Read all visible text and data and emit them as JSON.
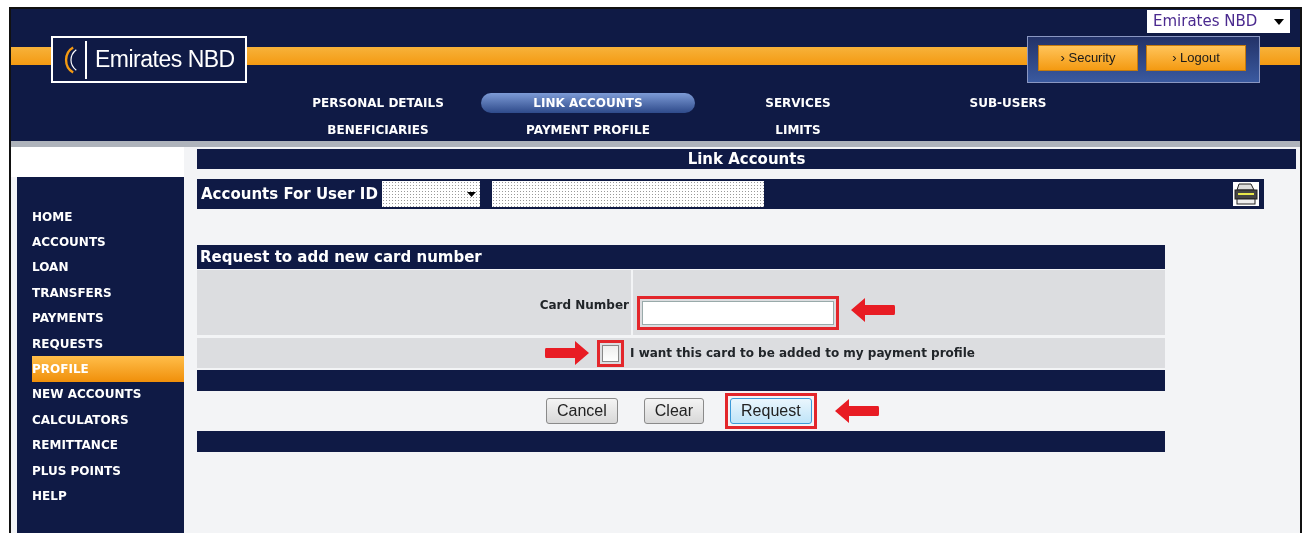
{
  "language_select": {
    "value": "Emirates NBD"
  },
  "logo": {
    "text": "Emirates NBD"
  },
  "header_buttons": [
    {
      "label": "› Security"
    },
    {
      "label": "› Logout"
    }
  ],
  "tabs": [
    {
      "label": "PERSONAL DETAILS",
      "selected": false
    },
    {
      "label": "LINK ACCOUNTS",
      "selected": true
    },
    {
      "label": "SERVICES",
      "selected": false
    },
    {
      "label": "SUB-USERS",
      "selected": false
    },
    {
      "label": "BENEFICIARIES",
      "selected": false
    },
    {
      "label": "PAYMENT PROFILE",
      "selected": false
    },
    {
      "label": "LIMITS",
      "selected": false
    }
  ],
  "sidebar": {
    "items": [
      {
        "label": "HOME",
        "selected": false
      },
      {
        "label": "ACCOUNTS",
        "selected": false
      },
      {
        "label": "LOAN",
        "selected": false
      },
      {
        "label": "TRANSFERS",
        "selected": false
      },
      {
        "label": "PAYMENTS",
        "selected": false
      },
      {
        "label": "REQUESTS",
        "selected": false
      },
      {
        "label": "PROFILE",
        "selected": true
      },
      {
        "label": "NEW ACCOUNTS",
        "selected": false
      },
      {
        "label": "CALCULATORS",
        "selected": false
      },
      {
        "label": "REMITTANCE",
        "selected": false
      },
      {
        "label": "PLUS POINTS",
        "selected": false
      },
      {
        "label": "HELP",
        "selected": false
      }
    ]
  },
  "page_title": "Link Accounts",
  "accounts_bar": {
    "label": "Accounts For User ID"
  },
  "form": {
    "title": "Request to add new card number",
    "card_number": {
      "label": "Card Number",
      "highlighted": true
    },
    "payment_profile_checkbox": {
      "label": "I want this card to be added to my payment profile",
      "checked": false,
      "highlighted": true
    },
    "buttons": [
      {
        "label": "Cancel",
        "highlighted": false
      },
      {
        "label": "Clear",
        "highlighted": false
      },
      {
        "label": "Request",
        "highlighted": true
      }
    ]
  }
}
